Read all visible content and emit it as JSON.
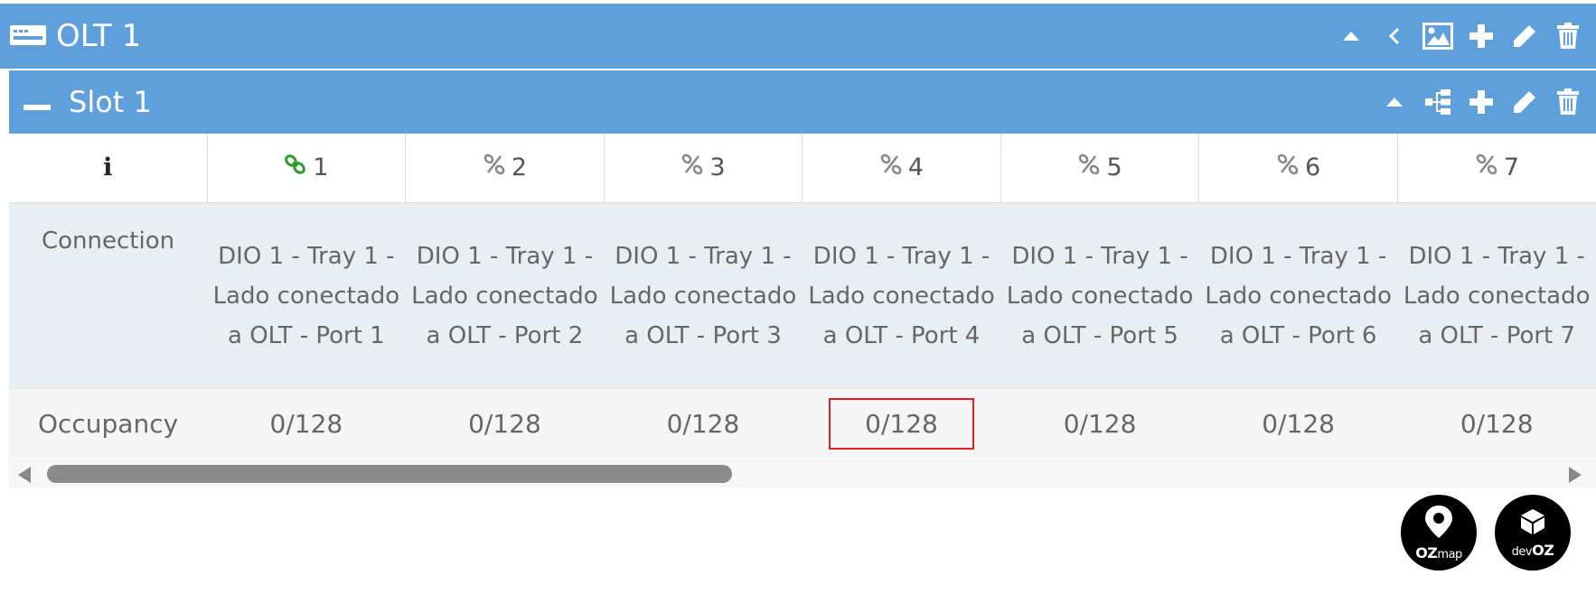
{
  "olt": {
    "title": "OLT 1"
  },
  "slot": {
    "title": "Slot 1"
  },
  "table": {
    "info_header": "i",
    "ports": [
      {
        "number": "1",
        "connected": true
      },
      {
        "number": "2",
        "connected": false
      },
      {
        "number": "3",
        "connected": false
      },
      {
        "number": "4",
        "connected": false
      },
      {
        "number": "5",
        "connected": false
      },
      {
        "number": "6",
        "connected": false
      },
      {
        "number": "7",
        "connected": false
      }
    ],
    "rows": {
      "connection_label": "Connection",
      "occupancy_label": "Occupancy",
      "connections": [
        "DIO 1 - Tray 1 - Lado conectado a OLT - Port 1",
        "DIO 1 - Tray 1 - Lado conectado a OLT - Port 2",
        "DIO 1 - Tray 1 - Lado conectado a OLT - Port 3",
        "DIO 1 - Tray 1 - Lado conectado a OLT - Port 4",
        "DIO 1 - Tray 1 - Lado conectado a OLT - Port 5",
        "DIO 1 - Tray 1 - Lado conectado a OLT - Port 6",
        "DIO 1 - Tray 1 - Lado conectado a OLT - Port 7"
      ],
      "occupancy": [
        "0/128",
        "0/128",
        "0/128",
        "0/128",
        "0/128",
        "0/128",
        "0/128"
      ],
      "highlighted_occupancy_index": 3
    }
  },
  "logos": {
    "ozmap": {
      "bold": "OZ",
      "light": "map"
    },
    "devoz": {
      "light": "dev",
      "bold": "OZ"
    }
  },
  "colors": {
    "header": "#5fa0dc",
    "connected_icon": "#2e9a2e",
    "highlight_border": "#e02020"
  }
}
